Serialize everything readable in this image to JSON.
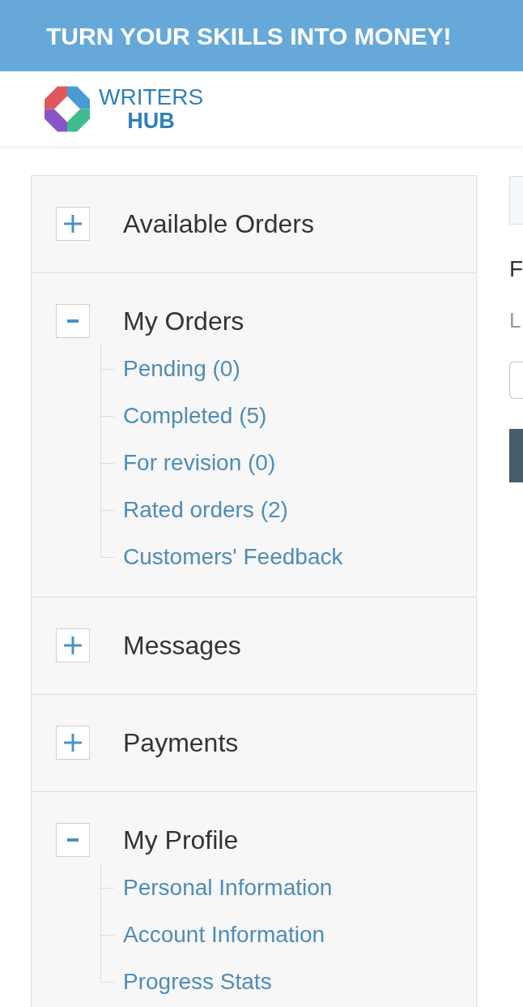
{
  "banner": {
    "text": "TURN YOUR SKILLS INTO MONEY!"
  },
  "header": {
    "logo": {
      "line_1": "WRITERS",
      "line_2": "HUB"
    }
  },
  "sidebar": {
    "sections": [
      {
        "title": "Available Orders",
        "expanded": false
      },
      {
        "title": "My Orders",
        "expanded": true,
        "children": [
          {
            "label": "Pending (0)"
          },
          {
            "label": "Completed (5)"
          },
          {
            "label": "For revision (0)"
          },
          {
            "label": "Rated orders (2)"
          },
          {
            "label": "Customers' Feedback"
          }
        ]
      },
      {
        "title": "Messages",
        "expanded": false
      },
      {
        "title": "Payments",
        "expanded": false
      },
      {
        "title": "My Profile",
        "expanded": true,
        "children": [
          {
            "label": "Personal Information"
          },
          {
            "label": "Account Information"
          },
          {
            "label": "Progress Stats"
          }
        ]
      }
    ]
  },
  "content": {
    "heading": "F",
    "subheading": "L"
  }
}
